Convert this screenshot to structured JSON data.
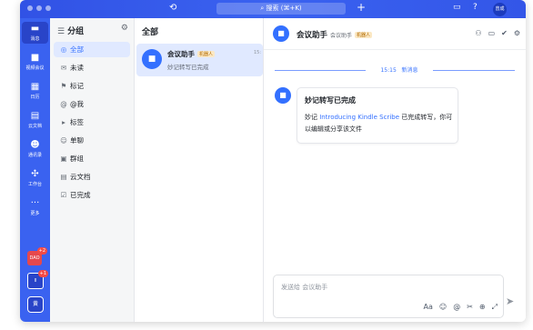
{
  "titlebar": {
    "history_icon": "clock-history-icon",
    "search_placeholder": "搜索 (⌘+K)",
    "plus_icon": "plus-icon",
    "avatar_text": "曾成"
  },
  "sidebar": {
    "items": [
      {
        "label": "消息",
        "icon": "chat-bubble-icon"
      },
      {
        "label": "视频会议",
        "icon": "video-icon"
      },
      {
        "label": "日历",
        "icon": "calendar-icon"
      },
      {
        "label": "云文档",
        "icon": "document-icon"
      },
      {
        "label": "通讯录",
        "icon": "contacts-icon"
      },
      {
        "label": "工作台",
        "icon": "apps-grid-icon"
      },
      {
        "label": "更多",
        "icon": "more-dots-icon"
      }
    ],
    "apps": [
      {
        "text": "DAO",
        "count": "+2",
        "color": "#e5484d"
      },
      {
        "text": "Il",
        "count": "+1",
        "color": "#2944c8"
      }
    ],
    "self_avatar": "黄"
  },
  "groups": {
    "title": "分组",
    "items": [
      {
        "label": "全部",
        "icon": "≡"
      },
      {
        "label": "未读",
        "icon": "✉"
      },
      {
        "label": "标记",
        "icon": "⚑"
      },
      {
        "label": "@我",
        "icon": "@"
      },
      {
        "label": "标签",
        "icon": "▸"
      },
      {
        "label": "单聊",
        "icon": "☺"
      },
      {
        "label": "群组",
        "icon": "▣"
      },
      {
        "label": "云文档",
        "icon": "▤"
      },
      {
        "label": "已完成",
        "icon": "☑"
      }
    ]
  },
  "list": {
    "title": "全部",
    "conversation": {
      "name": "会议助手",
      "tag": "机器人",
      "preview": "妙记转写已完成",
      "time": "15:"
    }
  },
  "chat": {
    "name": "会议助手",
    "subtitle": "会议助手",
    "tag": "机器人",
    "divider_time": "15:15",
    "divider_label": "新消息",
    "card": {
      "title": "妙记转写已完成",
      "body_prefix": "妙记 ",
      "link": "Introducing Kindle Scribe",
      "body_suffix": " 已完成转写，你可以编辑或分享该文件"
    },
    "input_placeholder": "发送给 会议助手"
  },
  "colors": {
    "accent": "#3370ff",
    "sidebar": "#3a62f0"
  }
}
